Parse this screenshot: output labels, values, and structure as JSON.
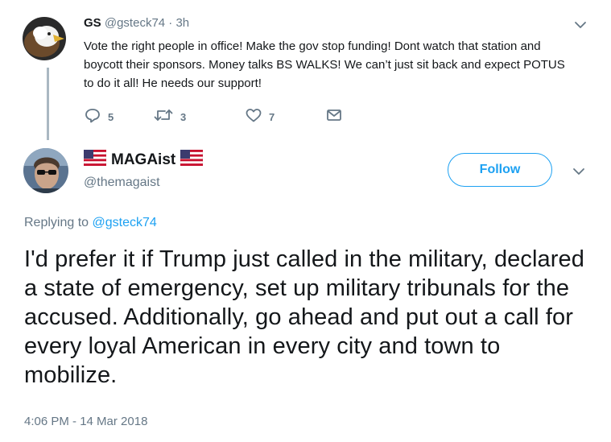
{
  "reply_tweet": {
    "author_name": "GS",
    "author_handle": "@gsteck74",
    "separator": "·",
    "time": "3h",
    "text": "Vote the right people in office! Make the gov stop funding!  Dont watch that station and boycott their sponsors.  Money talks BS WALKS!  We can’t just sit back and expect POTUS to do it all!  He needs our support!",
    "reply_count": "5",
    "retweet_count": "3",
    "like_count": "7",
    "icons": [
      "reply-icon",
      "retweet-icon",
      "like-icon",
      "message-icon",
      "chevron-down-icon"
    ]
  },
  "main_tweet": {
    "author_name": "MAGAist",
    "author_handle": "@themagaist",
    "follow_label": "Follow",
    "replying_prefix": "Replying to",
    "replying_to": "@gsteck74",
    "text": "I'd prefer it if Trump just called in the military, declared a state of emergency, set up military tribunals for the accused. Additionally, go ahead and put out a call for every loyal American in every city and town to mobilize.",
    "timestamp": "4:06 PM - 14 Mar 2018",
    "icons": [
      "us-flag-icon",
      "chevron-down-icon"
    ]
  },
  "colors": {
    "accent": "#1da1f2",
    "muted": "#657786",
    "text": "#14171a",
    "thread_line": "#aab8c2"
  }
}
